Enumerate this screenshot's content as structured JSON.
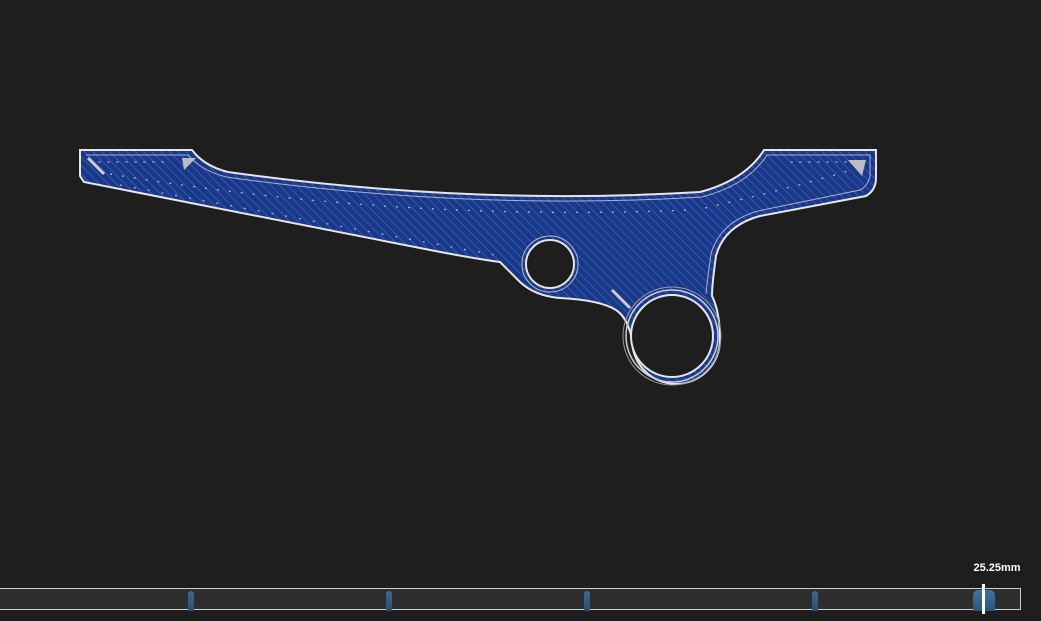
{
  "viewer": {
    "background_color": "#1e1e1e",
    "part_fill_color": "#1d3a8a",
    "outline_color": "#e8e8e8"
  },
  "layer_slider": {
    "current_value_label": "25.25mm",
    "marker_count": 5
  }
}
